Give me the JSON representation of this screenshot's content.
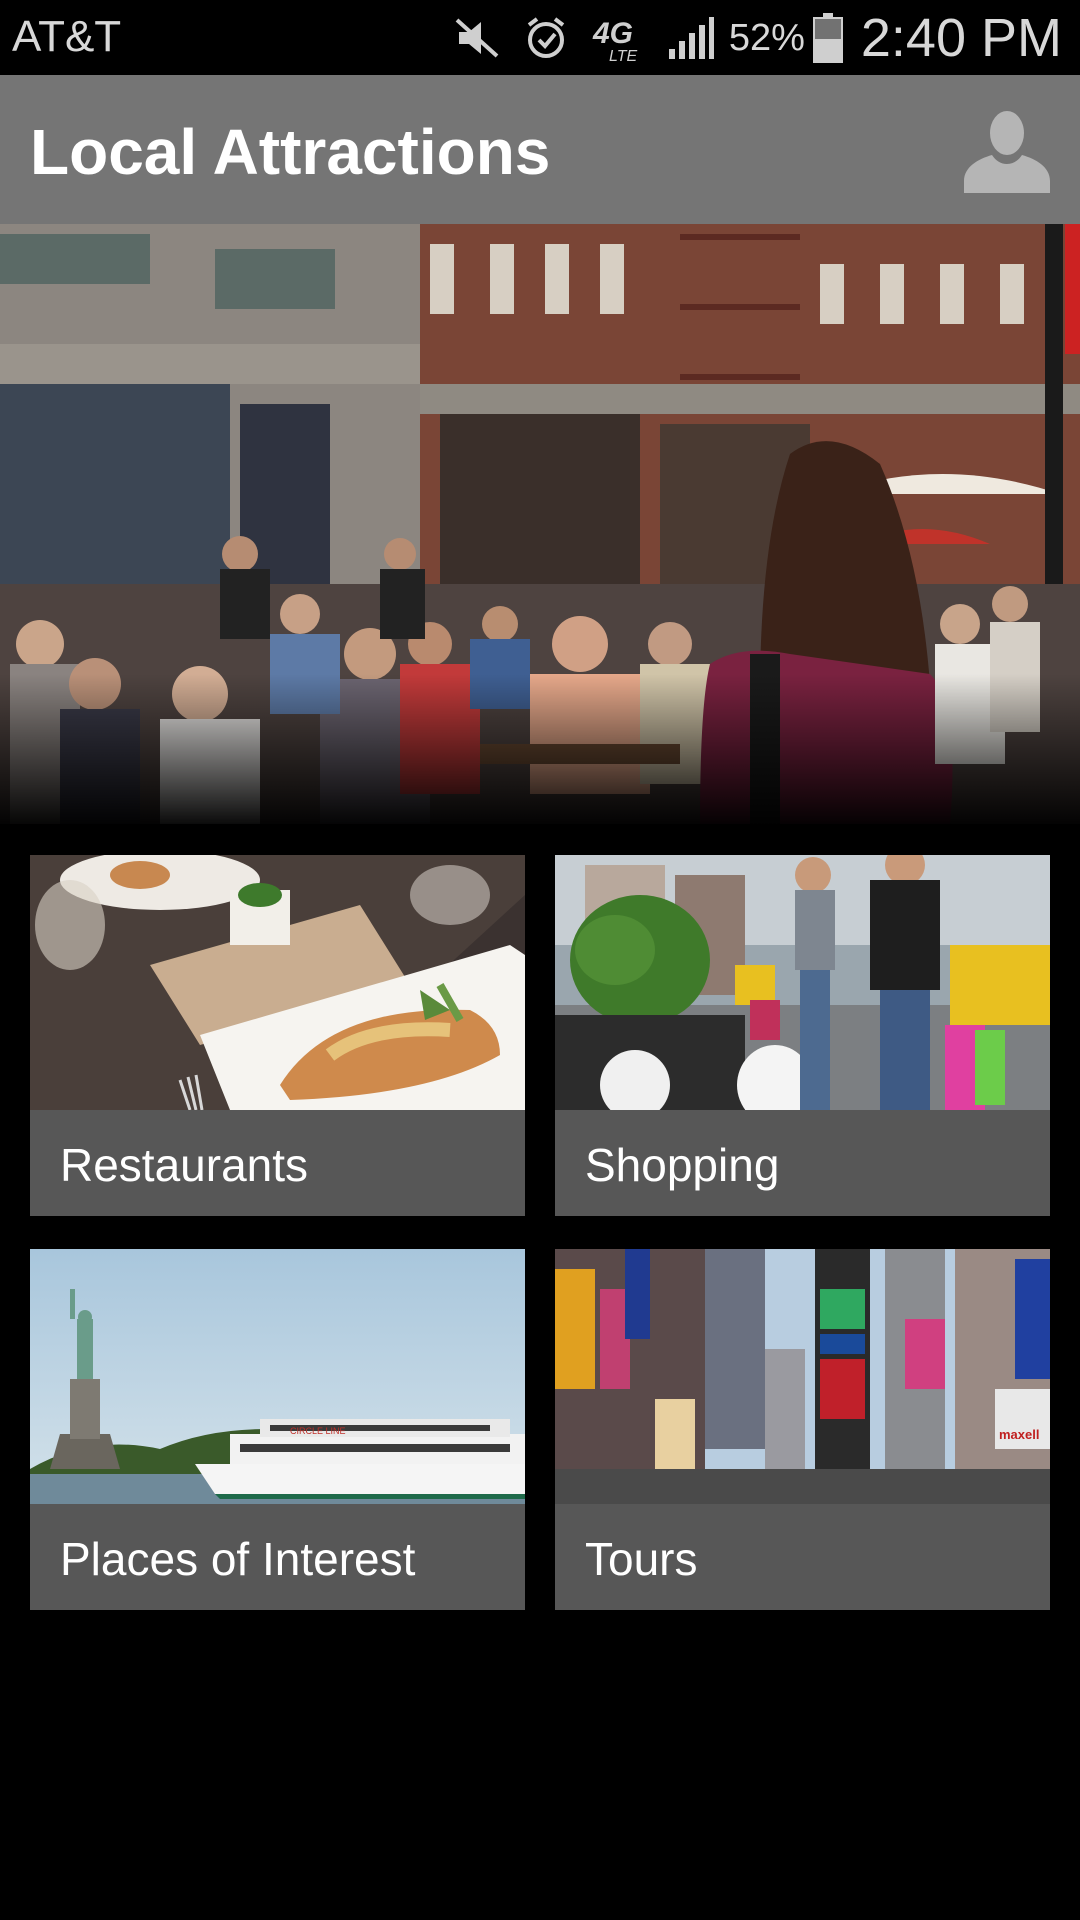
{
  "status_bar": {
    "carrier": "AT&T",
    "network": "4G LTE",
    "battery": "52%",
    "time": "2:40 PM",
    "icons": [
      "mute-icon",
      "alarm-icon",
      "lte-icon",
      "signal-icon",
      "battery-icon"
    ]
  },
  "app_bar": {
    "title": "Local Attractions",
    "profile_icon": "person-icon"
  },
  "hero": {
    "image": "street-cafe-photo"
  },
  "tiles": [
    {
      "label": "Restaurants",
      "image": "restaurant-dish-photo"
    },
    {
      "label": "Shopping",
      "image": "shopping-couple-photo"
    },
    {
      "label": "Places of Interest",
      "image": "statue-of-liberty-photo"
    },
    {
      "label": "Tours",
      "image": "times-square-photo"
    }
  ],
  "colors": {
    "app_bar": "#757575",
    "tile_label_bg": "#575757",
    "background": "#000000"
  }
}
